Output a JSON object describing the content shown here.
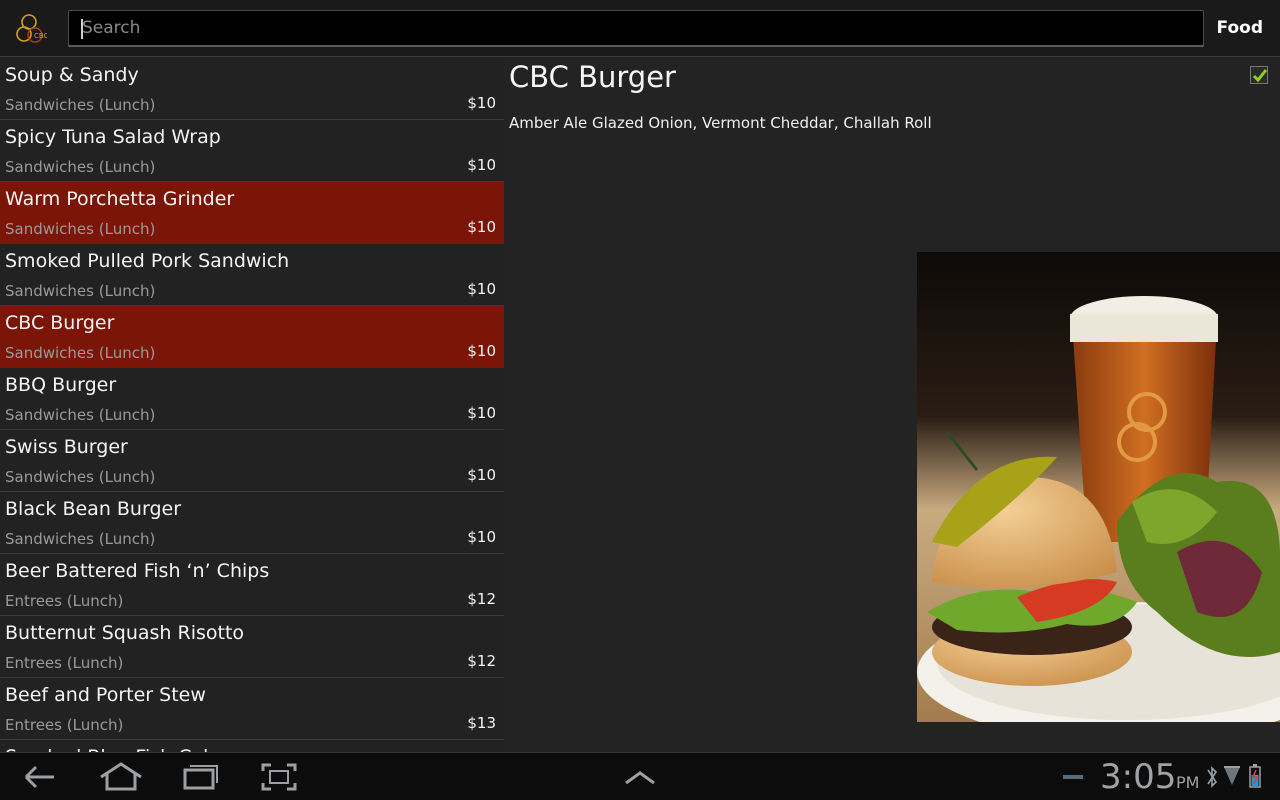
{
  "action_bar": {
    "logo_icon": "cbc-logo-icon",
    "search_placeholder": "Search",
    "tab_label": "Food"
  },
  "menu": {
    "items": [
      {
        "name": "Soup & Sandy",
        "category": "Sandwiches (Lunch)",
        "price": "$10",
        "selected": false
      },
      {
        "name": "Spicy Tuna Salad Wrap",
        "category": "Sandwiches (Lunch)",
        "price": "$10",
        "selected": false
      },
      {
        "name": "Warm Porchetta Grinder",
        "category": "Sandwiches (Lunch)",
        "price": "$10",
        "selected": true
      },
      {
        "name": "Smoked Pulled Pork Sandwich",
        "category": "Sandwiches (Lunch)",
        "price": "$10",
        "selected": false
      },
      {
        "name": "CBC Burger",
        "category": "Sandwiches (Lunch)",
        "price": "$10",
        "selected": true
      },
      {
        "name": "BBQ Burger",
        "category": "Sandwiches (Lunch)",
        "price": "$10",
        "selected": false
      },
      {
        "name": "Swiss Burger",
        "category": "Sandwiches (Lunch)",
        "price": "$10",
        "selected": false
      },
      {
        "name": "Black Bean Burger",
        "category": "Sandwiches (Lunch)",
        "price": "$10",
        "selected": false
      },
      {
        "name": "Beer Battered Fish ‘n’ Chips",
        "category": "Entrees (Lunch)",
        "price": "$12",
        "selected": false
      },
      {
        "name": "Butternut Squash Risotto",
        "category": "Entrees (Lunch)",
        "price": "$12",
        "selected": false
      },
      {
        "name": "Beef and Porter Stew",
        "category": "Entrees (Lunch)",
        "price": "$13",
        "selected": false
      },
      {
        "name": "Smoked Blue Fish Cakes",
        "category": "",
        "price": "",
        "selected": false
      }
    ]
  },
  "detail": {
    "title": "CBC Burger",
    "description": "Amber Ale Glazed Onion, Vermont Cheddar, Challah Roll",
    "checked": true,
    "image_icon": "burger-and-beer-photo"
  },
  "system_bar": {
    "time": "3:05",
    "ampm": "PM",
    "icons": [
      "back-icon",
      "home-icon",
      "recent-apps-icon",
      "screenshot-icon",
      "up-chevron-icon",
      "usb-icon",
      "bluetooth-icon",
      "signal-icon",
      "battery-icon"
    ]
  },
  "colors": {
    "selected_row": "#7a1508",
    "background": "#232323",
    "check_green": "#8fd11a"
  }
}
